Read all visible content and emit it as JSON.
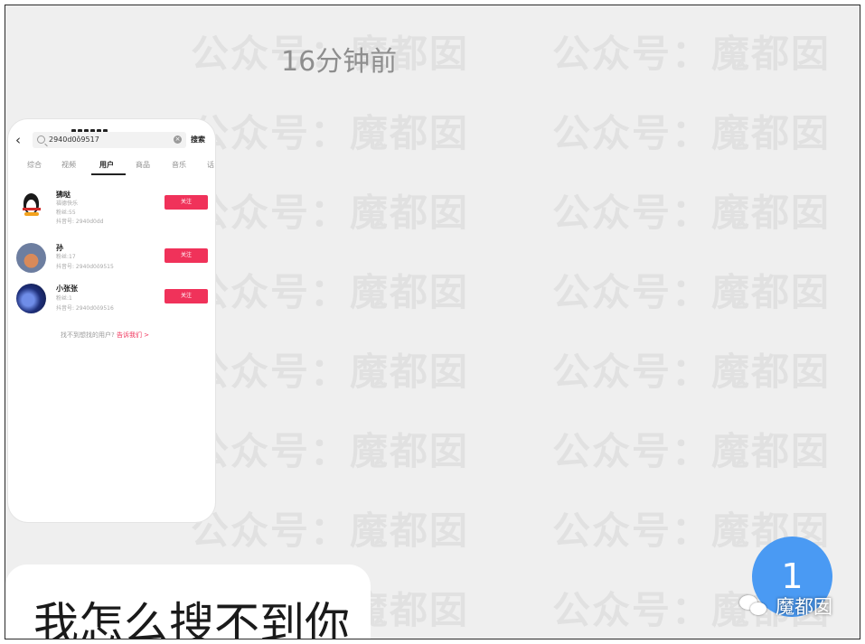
{
  "chat": {
    "timestamp": "16分钟前",
    "message_text": "我怎么搜不到你",
    "unread_count": "1"
  },
  "watermark": {
    "brand": "魔都囡"
  },
  "screenshot": {
    "search": {
      "query": "2940d0ô9517",
      "search_button": "搜索"
    },
    "tabs": [
      {
        "label": "综合"
      },
      {
        "label": "视频"
      },
      {
        "label": "用户"
      },
      {
        "label": "商品"
      },
      {
        "label": "音乐"
      },
      {
        "label": "话"
      }
    ],
    "active_tab": "用户",
    "users": [
      {
        "name": "狒哒",
        "line1": "福德快乐",
        "line2": "粉丝:55",
        "line3": "抖音号: 2940d0dd",
        "button": "关注"
      },
      {
        "name": "孙",
        "line1": "粉丝:17",
        "line2": "抖音号: 2940d0ô9515",
        "line3": "",
        "button": "关注"
      },
      {
        "name": "小张张",
        "line1": "粉丝:1",
        "line2": "抖音号: 2940d0ô9516",
        "line3": "",
        "button": "关注"
      }
    ],
    "footer_hint": "找不到想找的用户?",
    "footer_link": "告诉我们 >"
  },
  "colors": {
    "badge": "#4a9af3",
    "follow_button": "#f0325a",
    "background": "#efefef"
  }
}
